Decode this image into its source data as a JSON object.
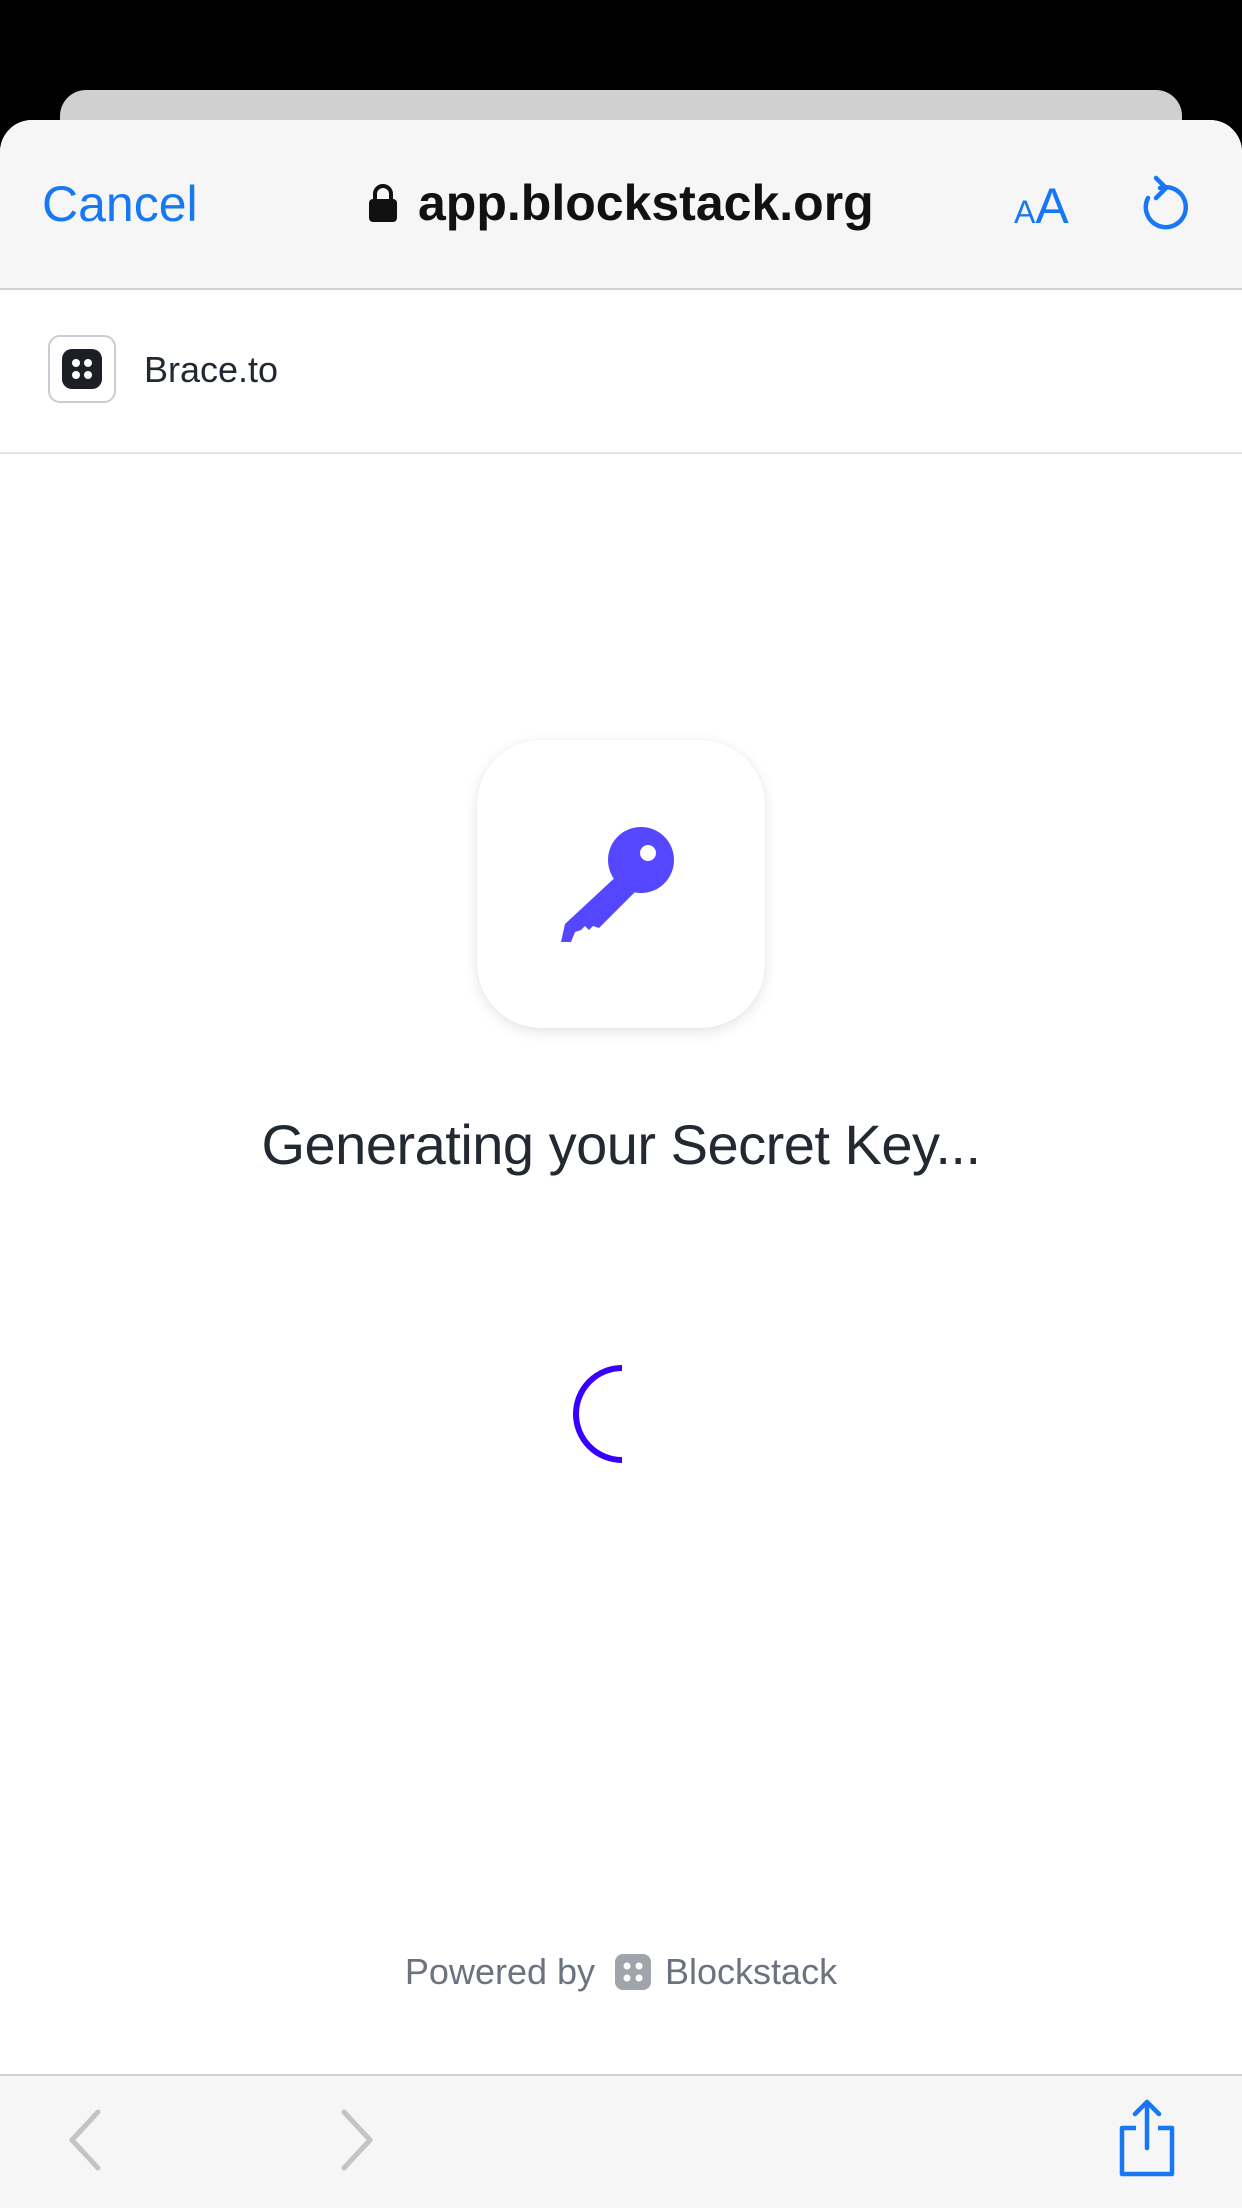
{
  "browser": {
    "cancel_label": "Cancel",
    "url": "app.blockstack.org",
    "text_size_small": "A",
    "text_size_big": "A"
  },
  "app_header": {
    "app_name": "Brace.to"
  },
  "main": {
    "status_text": "Generating your Secret Key...",
    "key_icon": "key-icon",
    "accent_color": "#5546ff",
    "spinner_color": "#3700ff"
  },
  "footer": {
    "powered_by": "Powered by",
    "brand": "Blockstack"
  },
  "toolbar": {
    "icons": [
      "chevron-left-icon",
      "chevron-right-icon",
      "share-icon"
    ],
    "accent_color": "#1877f2"
  }
}
